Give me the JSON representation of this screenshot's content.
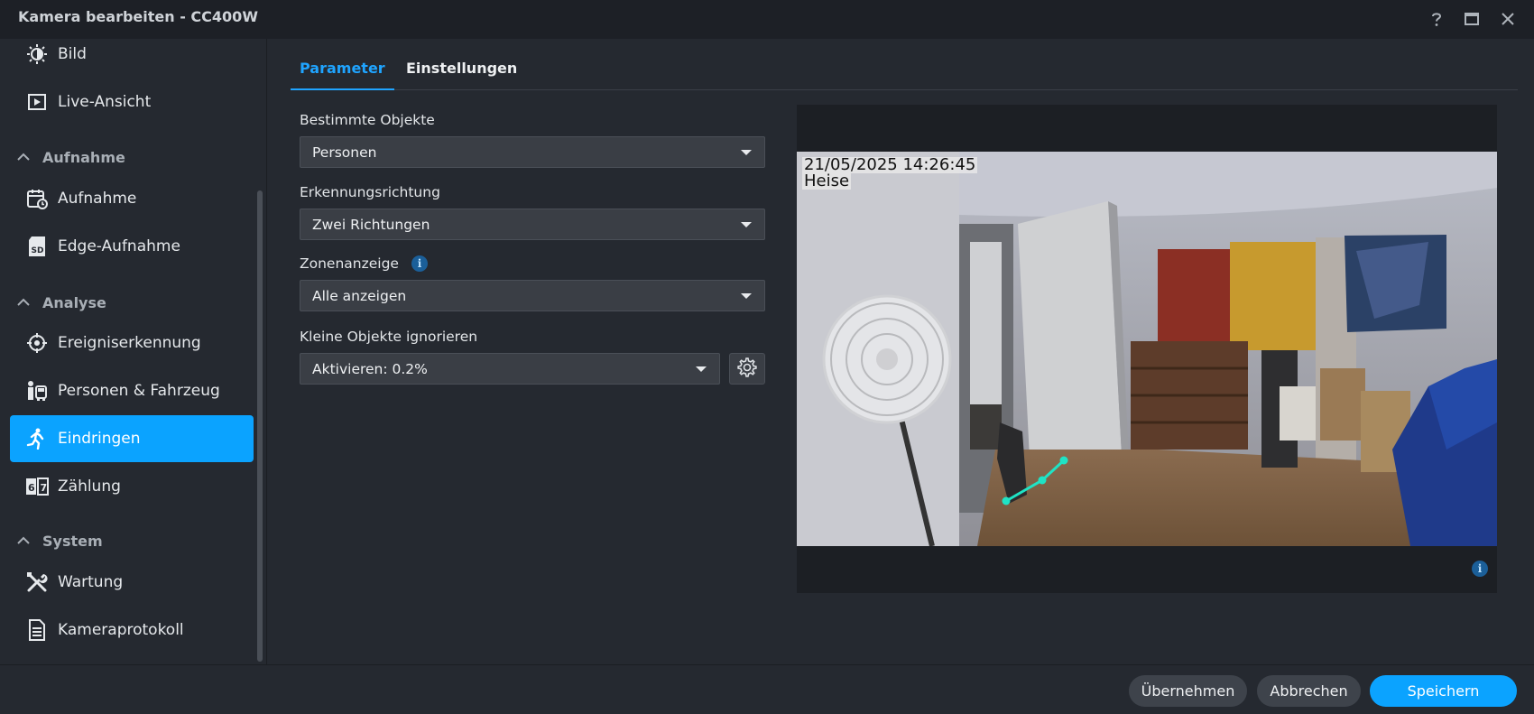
{
  "window": {
    "title": "Kamera bearbeiten - CC400W",
    "help_icon": "question-icon",
    "maximize_icon": "maximize-icon",
    "close_icon": "close-icon"
  },
  "sidebar": {
    "items": [
      {
        "label": "Bild",
        "icon": "brightness-icon"
      },
      {
        "label": "Live-Ansicht",
        "icon": "play-box-icon"
      },
      {
        "label": "Aufnahme",
        "icon": "calendar-record-icon"
      },
      {
        "label": "Edge-Aufnahme",
        "icon": "sd-card-icon"
      },
      {
        "label": "Ereigniserkennung",
        "icon": "crosshair-icon"
      },
      {
        "label": "Personen & Fahrzeug",
        "icon": "person-car-icon"
      },
      {
        "label": "Eindringen",
        "icon": "running-person-icon"
      },
      {
        "label": "Zählung",
        "icon": "counter-icon"
      },
      {
        "label": "Wartung",
        "icon": "tools-icon"
      },
      {
        "label": "Kameraprotokoll",
        "icon": "log-list-icon"
      }
    ],
    "groups": [
      {
        "label": "Aufnahme"
      },
      {
        "label": "Analyse"
      },
      {
        "label": "System"
      }
    ],
    "active_item": "Eindringen"
  },
  "tabs": [
    {
      "label": "Parameter",
      "active": true
    },
    {
      "label": "Einstellungen",
      "active": false
    }
  ],
  "form": {
    "objects_label": "Bestimmte Objekte",
    "objects_value": "Personen",
    "direction_label": "Erkennungsrichtung",
    "direction_value": "Zwei Richtungen",
    "zone_label": "Zonenanzeige",
    "zone_value": "Alle anzeigen",
    "small_label": "Kleine Objekte ignorieren",
    "small_value": "Aktivieren: 0.2%"
  },
  "preview": {
    "timestamp": "21/05/2025 14:26:45",
    "camera_name": "Heise",
    "line_color": "#1fe3c5"
  },
  "footer": {
    "apply_label": "Übernehmen",
    "cancel_label": "Abbrechen",
    "save_label": "Speichern"
  },
  "colors": {
    "accent": "#0ba3ff",
    "background": "#252930",
    "titlebar": "#1d2026"
  }
}
